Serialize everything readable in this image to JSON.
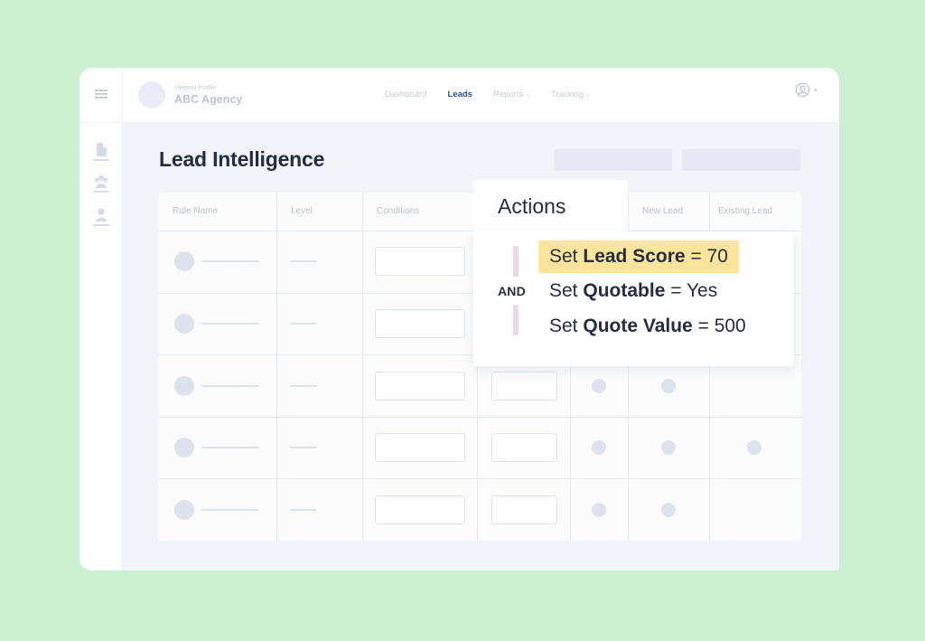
{
  "colors": {
    "background": "#ccf0d2",
    "accent_nav": "#2e4f8f",
    "highlight": "#fbe59a",
    "and_bar": "#ebd8ea",
    "title_text": "#262d42"
  },
  "topbar": {
    "menu_icon": "hamburger-icon",
    "profile": {
      "kicker": "Viewing Profile",
      "name": "ABC Agency"
    },
    "nav": [
      {
        "label": "Dashboard",
        "active": false,
        "has_dropdown": false
      },
      {
        "label": "Leads",
        "active": true,
        "has_dropdown": false
      },
      {
        "label": "Reports",
        "active": false,
        "has_dropdown": true
      },
      {
        "label": "Tracking",
        "active": false,
        "has_dropdown": true
      }
    ],
    "chevron": "⌄",
    "user_icon": "user-circle-icon",
    "user_caret": "▾"
  },
  "sidebar": {
    "items": [
      {
        "icon": "building-icon"
      },
      {
        "icon": "team-icon"
      },
      {
        "icon": "person-icon"
      }
    ]
  },
  "main": {
    "title": "Lead Intelligence",
    "table": {
      "columns": [
        "Rule Name",
        "Level",
        "Conditions",
        "Actions",
        "New Lead",
        "Existing Lead"
      ],
      "rows": [
        {
          "new_lead": false,
          "existing_lead": false
        },
        {
          "new_lead": false,
          "existing_lead": false
        },
        {
          "new_lead": true,
          "existing_lead": false
        },
        {
          "new_lead": true,
          "existing_lead": true
        },
        {
          "new_lead": true,
          "existing_lead": false
        }
      ]
    },
    "actions_popup": {
      "title": "Actions",
      "connector": "AND",
      "items": [
        {
          "prefix": "Set",
          "field": "Lead Score",
          "operator": "=",
          "value": "70",
          "highlighted": true
        },
        {
          "prefix": "Set",
          "field": "Quotable",
          "operator": "=",
          "value": "Yes",
          "highlighted": false
        },
        {
          "prefix": "Set",
          "field": "Quote Value",
          "operator": "=",
          "value": "500",
          "highlighted": false
        }
      ]
    }
  }
}
